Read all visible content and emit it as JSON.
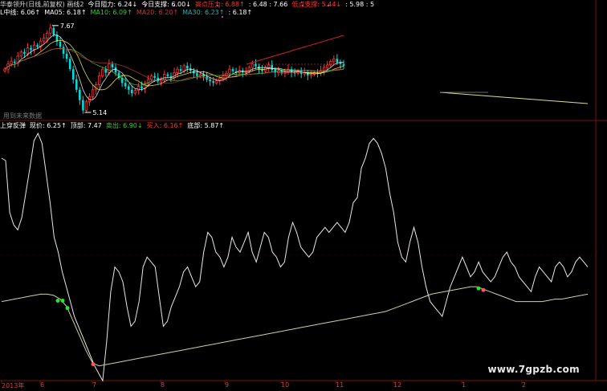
{
  "header_top": [
    {
      "text": "华泰领升(日线,前复权) 画线2",
      "color": "#d8d8d8"
    },
    {
      "text": "今日阻力: 6.24↓",
      "color": "#ffffff"
    },
    {
      "text": "今日支撑: 6.00↓",
      "color": "#ffffff"
    },
    {
      "text": "高点压力: 6.88↑",
      "color": "#ff3333"
    },
    {
      "text": ": 6.48 : 7.66",
      "color": "#ffffff"
    },
    {
      "text": "低点支撑: 5.44↓",
      "color": "#ff3333"
    },
    {
      "text": ": 5.98 : 5",
      "color": "#ffffff"
    }
  ],
  "header_ma": [
    {
      "text": "L中线: 6.06↑",
      "color": "#ffffff"
    },
    {
      "text": "MA05: 6.18↑",
      "color": "#ffffff"
    },
    {
      "text": "MA10: 6.09↑",
      "color": "#33cc33"
    },
    {
      "text": "MA20: 6.20↑",
      "color": "#cc3333"
    },
    {
      "text": "MA30: 6.23↑",
      "color": "#33aaaa"
    },
    {
      "text": ": 6.18↑",
      "color": "#ffffff"
    }
  ],
  "header_lower": [
    {
      "text": "上穿反弹",
      "color": "#ffffff"
    },
    {
      "text": "现价: 6.25↑",
      "color": "#ffffff"
    },
    {
      "text": "顶部: 7.47",
      "color": "#ffffff"
    },
    {
      "text": "卖出: 6.90↓",
      "color": "#33cc33"
    },
    {
      "text": "买入: 6.16↑",
      "color": "#ff3333"
    },
    {
      "text": "底部: 5.87↑",
      "color": "#ffffff"
    }
  ],
  "pane_note": "用到未来数据",
  "watermark": "www.7gpzb.com",
  "x_ticks": [
    "2013年",
    "6",
    "7",
    "8",
    "9",
    "10",
    "11",
    "12",
    "1",
    "2"
  ],
  "colors": {
    "up": "#ff3333",
    "down": "#00dddd",
    "ma5": "#ffffff",
    "ma10": "#ffff55",
    "ma20": "#44cc44",
    "ma30": "#cc3333",
    "grid": "#7a1010"
  },
  "chart_data": [
    {
      "type": "candlestick",
      "ylim": [
        5.0,
        7.9
      ],
      "annotations": [
        {
          "label": "7.67",
          "value": 7.67
        },
        {
          "label": "5.14",
          "value": 5.14
        }
      ],
      "series": [
        {
          "values": [
            6.4,
            6.55,
            6.62,
            6.58,
            6.78,
            6.9,
            6.85,
            7.02,
            6.96,
            7.1,
            7.05,
            7.22,
            7.3,
            7.45,
            7.6,
            7.4,
            7.2,
            7.05,
            6.85,
            6.7,
            6.4,
            6.1,
            5.8,
            5.5,
            5.2,
            5.45,
            5.6,
            5.8,
            5.95,
            6.2,
            6.4,
            6.3,
            6.55,
            6.45,
            6.3,
            6.15,
            6.0,
            5.9,
            5.8,
            5.7,
            5.78,
            5.9,
            5.84,
            5.98,
            6.1,
            6.2,
            6.15,
            6.05,
            6.1,
            6.25,
            6.2,
            6.15,
            6.3,
            6.4,
            6.35,
            6.5,
            6.42,
            6.35,
            6.28,
            6.2,
            6.25,
            6.18,
            6.1,
            6.05,
            6.0,
            6.06,
            6.12,
            6.2,
            6.28,
            6.4,
            6.34,
            6.3,
            6.36,
            6.3,
            6.34,
            6.45,
            6.55,
            6.48,
            6.4,
            6.35,
            6.45,
            6.52,
            6.38,
            6.3,
            6.35,
            6.28,
            6.32,
            6.4,
            6.3,
            6.28,
            6.35,
            6.26,
            6.3,
            6.22,
            6.25,
            6.3,
            6.28,
            6.36,
            6.45,
            6.52,
            6.62,
            6.7,
            6.6,
            6.55,
            6.5
          ]
        }
      ]
    },
    {
      "type": "line",
      "ylim": [
        0,
        100
      ],
      "series": [
        {
          "values": [
            88,
            87,
            66,
            61,
            59,
            64,
            74,
            84,
            95,
            98,
            94,
            82,
            70,
            56,
            50,
            42,
            36,
            30,
            24,
            20,
            16,
            12,
            8,
            4,
            1,
            -2,
            14,
            34,
            44,
            42,
            38,
            28,
            20,
            22,
            30,
            44,
            48,
            46,
            44,
            32,
            20,
            22,
            28,
            32,
            36,
            42,
            44,
            40,
            36,
            38,
            50,
            58,
            56,
            50,
            48,
            44,
            48,
            56,
            52,
            50,
            54,
            58,
            50,
            46,
            52,
            58,
            56,
            50,
            48,
            44,
            46,
            56,
            62,
            58,
            52,
            50,
            48,
            50,
            56,
            58,
            60,
            58,
            60,
            62,
            60,
            58,
            62,
            70,
            72,
            84,
            88,
            94,
            96,
            94,
            90,
            84,
            74,
            66,
            54,
            48,
            46,
            54,
            60,
            54,
            44,
            36,
            30,
            28,
            26,
            24,
            30,
            36,
            40,
            44,
            48,
            44,
            40,
            42,
            46,
            42,
            40,
            38,
            40,
            44,
            48,
            50,
            46,
            44,
            40,
            38,
            36,
            34,
            40,
            44,
            42,
            40,
            38,
            44,
            46,
            44,
            40,
            42,
            46,
            48,
            46,
            44
          ]
        },
        {
          "values": [
            30,
            30.5,
            31,
            31.5,
            32,
            32.5,
            33,
            33,
            32.5,
            31,
            28,
            22,
            16,
            10,
            5,
            4,
            4.5,
            5,
            5.5,
            6,
            6.5,
            7,
            7.5,
            8,
            8.5,
            9,
            9.5,
            10,
            10.5,
            11,
            11.5,
            12,
            12.5,
            13,
            13.5,
            14,
            14.5,
            15,
            15.5,
            16,
            16.5,
            17,
            17.5,
            18,
            18.5,
            19,
            19.5,
            20,
            20.5,
            21,
            21.5,
            22,
            22.5,
            23,
            23.5,
            24,
            24.5,
            25,
            25.5,
            26,
            27,
            28,
            29,
            30,
            31,
            32,
            33,
            33.5,
            34,
            34.5,
            35,
            35.5,
            36,
            36,
            35,
            34,
            33,
            32,
            31,
            30,
            30,
            30,
            30,
            30,
            30.5,
            31,
            31,
            31.5,
            32,
            32.5,
            33
          ]
        }
      ]
    }
  ]
}
